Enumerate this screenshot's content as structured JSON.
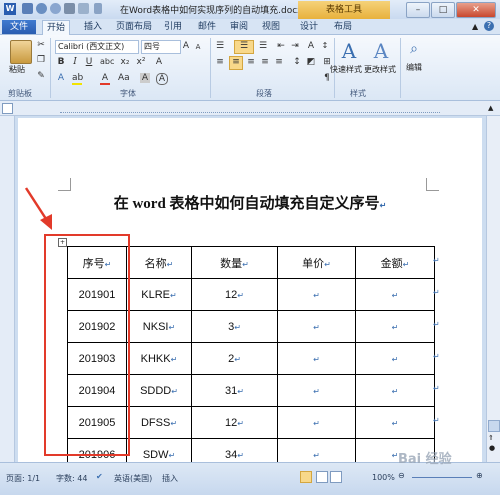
{
  "window": {
    "title": "在Word表格中如何实现序列的自动填充.docx M...",
    "contextual_tab": "表格工具",
    "app_icon": "W"
  },
  "tabs": [
    {
      "label": "文件"
    },
    {
      "label": "开始"
    },
    {
      "label": "插入"
    },
    {
      "label": "页面布局"
    },
    {
      "label": "引用"
    },
    {
      "label": "邮件"
    },
    {
      "label": "审阅"
    },
    {
      "label": "视图"
    },
    {
      "label": "设计"
    },
    {
      "label": "布局"
    }
  ],
  "ribbon": {
    "paste_label": "粘贴",
    "font_name": "Calibri (西文正文)",
    "font_size": "四号",
    "quick_styles_label": "快速样式",
    "change_styles_label": "更改样式",
    "edit_label": "编辑",
    "groups": {
      "clipboard": "剪贴板",
      "font": "字体",
      "paragraph": "段落",
      "styles": "样式"
    }
  },
  "document": {
    "title": "在 word 表格中如何自动填充自定义序号",
    "table": {
      "header": [
        "序号",
        "名称",
        "数量",
        "单价",
        "金额"
      ],
      "rows": [
        [
          "201901",
          "KLRE",
          "12",
          "",
          ""
        ],
        [
          "201902",
          "NKSI",
          "3",
          "",
          ""
        ],
        [
          "201903",
          "KHKK",
          "2",
          "",
          ""
        ],
        [
          "201904",
          "SDDD",
          "31",
          "",
          ""
        ],
        [
          "201905",
          "DFSS",
          "12",
          "",
          ""
        ],
        [
          "201906",
          "SDW",
          "34",
          "",
          ""
        ]
      ]
    },
    "cell_mark": "↵",
    "para_mark": "↵"
  },
  "status": {
    "page": "页面: 1/1",
    "words": "字数: 44",
    "language": "英语(美国)",
    "mode": "插入",
    "zoom": "100%"
  },
  "watermark": "Bai 经验",
  "colors": {
    "annotation_red": "#e23a2a",
    "file_tab_blue": "#2a5db0",
    "contextual_tab_gold": "#e8b13c"
  }
}
